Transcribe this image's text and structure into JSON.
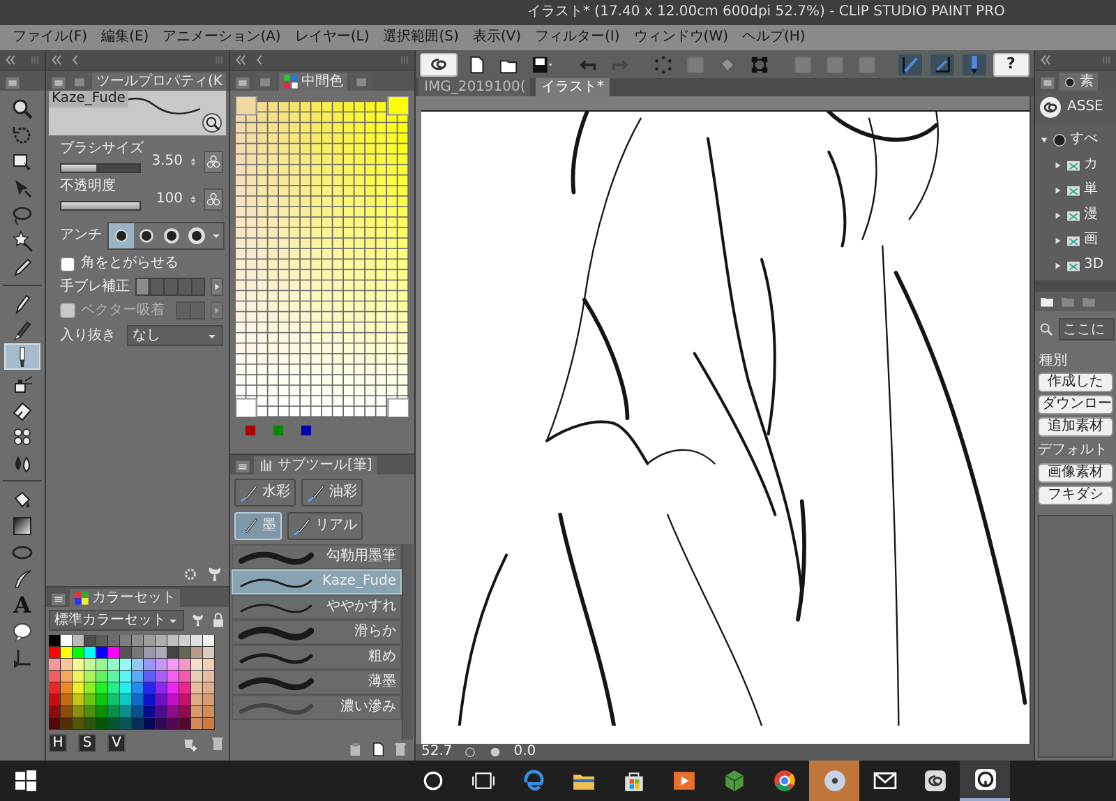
{
  "window": {
    "title": "イラスト* (17.40 x 12.00cm 600dpi 52.7%) - CLIP STUDIO PAINT PRO"
  },
  "menu": [
    "ファイル(F)",
    "編集(E)",
    "アニメーション(A)",
    "レイヤー(L)",
    "選択範囲(S)",
    "表示(V)",
    "フィルター(I)",
    "ウィンドウ(W)",
    "ヘルプ(H)"
  ],
  "tool_groups": [
    {
      "tools": [
        {
          "kind": "zoom",
          "selected": false
        },
        {
          "kind": "rotate",
          "selected": false
        },
        {
          "kind": "move",
          "selected": false
        },
        {
          "kind": "operation",
          "selected": false
        },
        {
          "kind": "lasso",
          "selected": false
        },
        {
          "kind": "wand",
          "selected": false
        },
        {
          "kind": "eyedropper",
          "selected": false
        }
      ]
    },
    {
      "tools": [
        {
          "kind": "pen",
          "selected": false
        },
        {
          "kind": "pencil",
          "selected": false
        },
        {
          "kind": "brush",
          "selected": true
        },
        {
          "kind": "airbrush",
          "selected": false
        },
        {
          "kind": "eraser",
          "selected": false
        },
        {
          "kind": "blend",
          "selected": false
        },
        {
          "kind": "droplets",
          "selected": false
        }
      ]
    },
    {
      "tools": [
        {
          "kind": "fill",
          "selected": false
        },
        {
          "kind": "gradient",
          "selected": false
        },
        {
          "kind": "figure",
          "selected": false
        },
        {
          "kind": "curve",
          "selected": false
        },
        {
          "kind": "text",
          "label": "A",
          "selected": false
        },
        {
          "kind": "balloon",
          "selected": false
        },
        {
          "kind": "ruler",
          "selected": false
        }
      ]
    }
  ],
  "tool_property": {
    "tabs": [
      {
        "kind": "icon",
        "selected": false
      },
      {
        "kind": "text",
        "label": "ツールプロパティ(K",
        "selected": true
      }
    ],
    "preview_name": "Kaze_Fude",
    "brush_size": {
      "label": "ブラシサイズ",
      "value": "3.50",
      "level": 0.45
    },
    "opacity": {
      "label": "不透明度",
      "value": "100",
      "level": 1
    },
    "anti_alias": {
      "label": "アンチ",
      "options": [
        {
          "selected": true
        },
        {
          "selected": false
        },
        {
          "selected": false
        },
        {
          "selected": false
        }
      ]
    },
    "sharp_corners": {
      "label": "角をとがらせる",
      "checked": false
    },
    "stabilization": {
      "label": "手ブレ補正",
      "level": 0.17
    },
    "vector_snap": {
      "label": "ベクター吸着",
      "checked": false,
      "disabled": true,
      "level": 0
    },
    "taper": {
      "label": "入り抜き",
      "value": "なし"
    }
  },
  "color_panel": {
    "tabs": [
      {
        "kind": "icon",
        "selected": false
      },
      {
        "kind": "text",
        "label": "中間色",
        "selected": true
      },
      {
        "kind": "icon",
        "selected": false
      }
    ]
  },
  "color_set": {
    "tab": "カラーセット",
    "set_name": "標準カラーセット",
    "modes": [
      "H",
      "S",
      "V"
    ]
  },
  "sub_tool": {
    "tab": "サブツール[筆]",
    "groups": [
      {
        "label": "水彩",
        "selected": false
      },
      {
        "label": "油彩",
        "selected": false
      },
      {
        "label": "墨",
        "selected": true
      },
      {
        "label": "リアル",
        "selected": false
      }
    ],
    "brushes": [
      {
        "name": "勾勒用墨筆",
        "selected": false
      },
      {
        "name": "Kaze_Fude",
        "selected": true
      },
      {
        "name": "ややかすれ",
        "selected": false
      },
      {
        "name": "滑らか",
        "selected": false
      },
      {
        "name": "粗め",
        "selected": false
      },
      {
        "name": "薄墨",
        "selected": false
      },
      {
        "name": "濃い滲み",
        "selected": false
      }
    ]
  },
  "toolbar": [
    {
      "kind": "logo",
      "disabled": false,
      "on": false
    },
    {
      "kind": "new",
      "disabled": false,
      "on": false
    },
    {
      "kind": "open",
      "disabled": false,
      "on": false
    },
    {
      "kind": "save",
      "disabled": false,
      "on": false
    },
    {
      "kind": "undo",
      "disabled": false,
      "on": false
    },
    {
      "kind": "redo",
      "disabled": true,
      "on": false
    },
    {
      "kind": "dots",
      "disabled": false,
      "on": false
    },
    {
      "kind": "square",
      "disabled": true,
      "on": false
    },
    {
      "kind": "bucket",
      "disabled": true,
      "on": false
    },
    {
      "kind": "crop",
      "disabled": false,
      "on": false
    },
    {
      "kind": "square",
      "disabled": true,
      "on": false
    },
    {
      "kind": "square",
      "disabled": true,
      "on": false
    },
    {
      "kind": "square",
      "disabled": true,
      "on": false
    },
    {
      "kind": "snap",
      "disabled": false,
      "on": true
    },
    {
      "kind": "snap_corner",
      "disabled": false,
      "on": true
    },
    {
      "kind": "snap_pen",
      "disabled": false,
      "on": true
    },
    {
      "kind": "help",
      "label": "?",
      "disabled": false,
      "on": false
    }
  ],
  "canvas": {
    "tabs": [
      {
        "label": "IMG_2019100(",
        "selected": false
      },
      {
        "label": "イラスト*",
        "selected": true
      }
    ],
    "zoom": "52.7",
    "angle": "0.0"
  },
  "materials": {
    "tab": "素",
    "title": "ASSE",
    "tree": [
      {
        "label": "すべ",
        "expanded": true,
        "children": [
          {
            "label": "カ",
            "expanded": false
          },
          {
            "label": "単",
            "expanded": false
          },
          {
            "label": "漫",
            "expanded": false
          },
          {
            "label": "画",
            "expanded": false
          },
          {
            "label": "3D",
            "expanded": false
          }
        ]
      }
    ],
    "search_placeholder": "ここに",
    "category_label": "種別",
    "filters": [
      "作成した",
      "ダウンロー",
      "追加素材"
    ],
    "default_label": "デフォルト",
    "tags": [
      "画像素材",
      "フキダシ"
    ]
  },
  "taskbar": [
    {
      "kind": "start",
      "selected": false,
      "hovered": false
    },
    {
      "kind": "search",
      "selected": false,
      "hovered": false
    },
    {
      "kind": "taskview",
      "selected": false,
      "hovered": false
    },
    {
      "kind": "edge",
      "selected": false,
      "hovered": false
    },
    {
      "kind": "explorer",
      "selected": false,
      "hovered": false
    },
    {
      "kind": "store",
      "selected": false,
      "hovered": false
    },
    {
      "kind": "media",
      "selected": false,
      "hovered": false
    },
    {
      "kind": "game",
      "selected": false,
      "hovered": false
    },
    {
      "kind": "chrome",
      "selected": false,
      "hovered": false
    },
    {
      "kind": "disc",
      "selected": false,
      "hovered": true
    },
    {
      "kind": "mail",
      "selected": false,
      "hovered": false
    },
    {
      "kind": "csp",
      "selected": false,
      "hovered": false
    },
    {
      "kind": "chat",
      "selected": true,
      "hovered": false
    }
  ]
}
